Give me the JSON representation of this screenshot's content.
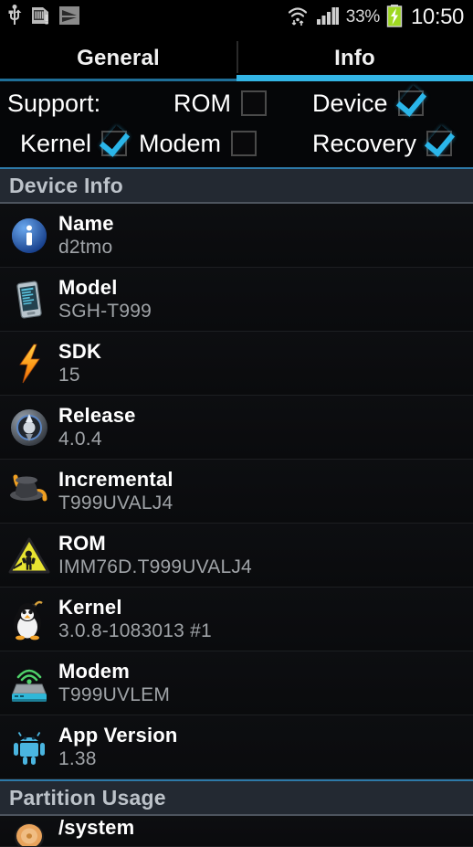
{
  "statusbar": {
    "icons": [
      "usb-icon",
      "sdcard-icon",
      "signal-flag-icon"
    ],
    "wifi_icon": "wifi-transfer-icon",
    "cell_icon": "cellular-signal-icon",
    "battery_percent": "33%",
    "battery_icon": "battery-charging-icon",
    "clock": "10:50"
  },
  "tabs": [
    {
      "label": "General",
      "active": false
    },
    {
      "label": "Info",
      "active": true
    }
  ],
  "support": {
    "title": "Support:",
    "items": [
      {
        "label": "ROM",
        "checked": false
      },
      {
        "label": "Device",
        "checked": true
      },
      {
        "label": "Kernel",
        "checked": true
      },
      {
        "label": "Modem",
        "checked": false
      },
      {
        "label": "Recovery",
        "checked": true
      }
    ]
  },
  "sections": [
    {
      "header": "Device Info",
      "rows": [
        {
          "icon": "info-circle-icon",
          "title": "Name",
          "value": "d2tmo"
        },
        {
          "icon": "phone-device-icon",
          "title": "Model",
          "value": "SGH-T999"
        },
        {
          "icon": "lightning-bolt-icon",
          "title": "SDK",
          "value": "15"
        },
        {
          "icon": "compass-icon",
          "title": "Release",
          "value": "4.0.4"
        },
        {
          "icon": "top-hat-icon",
          "title": "Incremental",
          "value": "T999UVALJ4"
        },
        {
          "icon": "warning-android-icon",
          "title": "ROM",
          "value": "IMM76D.T999UVALJ4"
        },
        {
          "icon": "penguin-bomb-icon",
          "title": "Kernel",
          "value": "3.0.8-1083013 #1"
        },
        {
          "icon": "modem-router-icon",
          "title": "Modem",
          "value": "T999UVLEM"
        },
        {
          "icon": "android-robot-icon",
          "title": "App Version",
          "value": "1.38"
        }
      ]
    },
    {
      "header": "Partition Usage",
      "rows": [
        {
          "icon": "disk-icon",
          "title": "/system",
          "value": ""
        }
      ]
    }
  ],
  "colors": {
    "accent": "#33b5e5",
    "tab_inactive_underline": "#1f6f98",
    "section_header_bg": "#232932",
    "row_title": "#ffffff",
    "row_value": "#9fa3a7"
  }
}
